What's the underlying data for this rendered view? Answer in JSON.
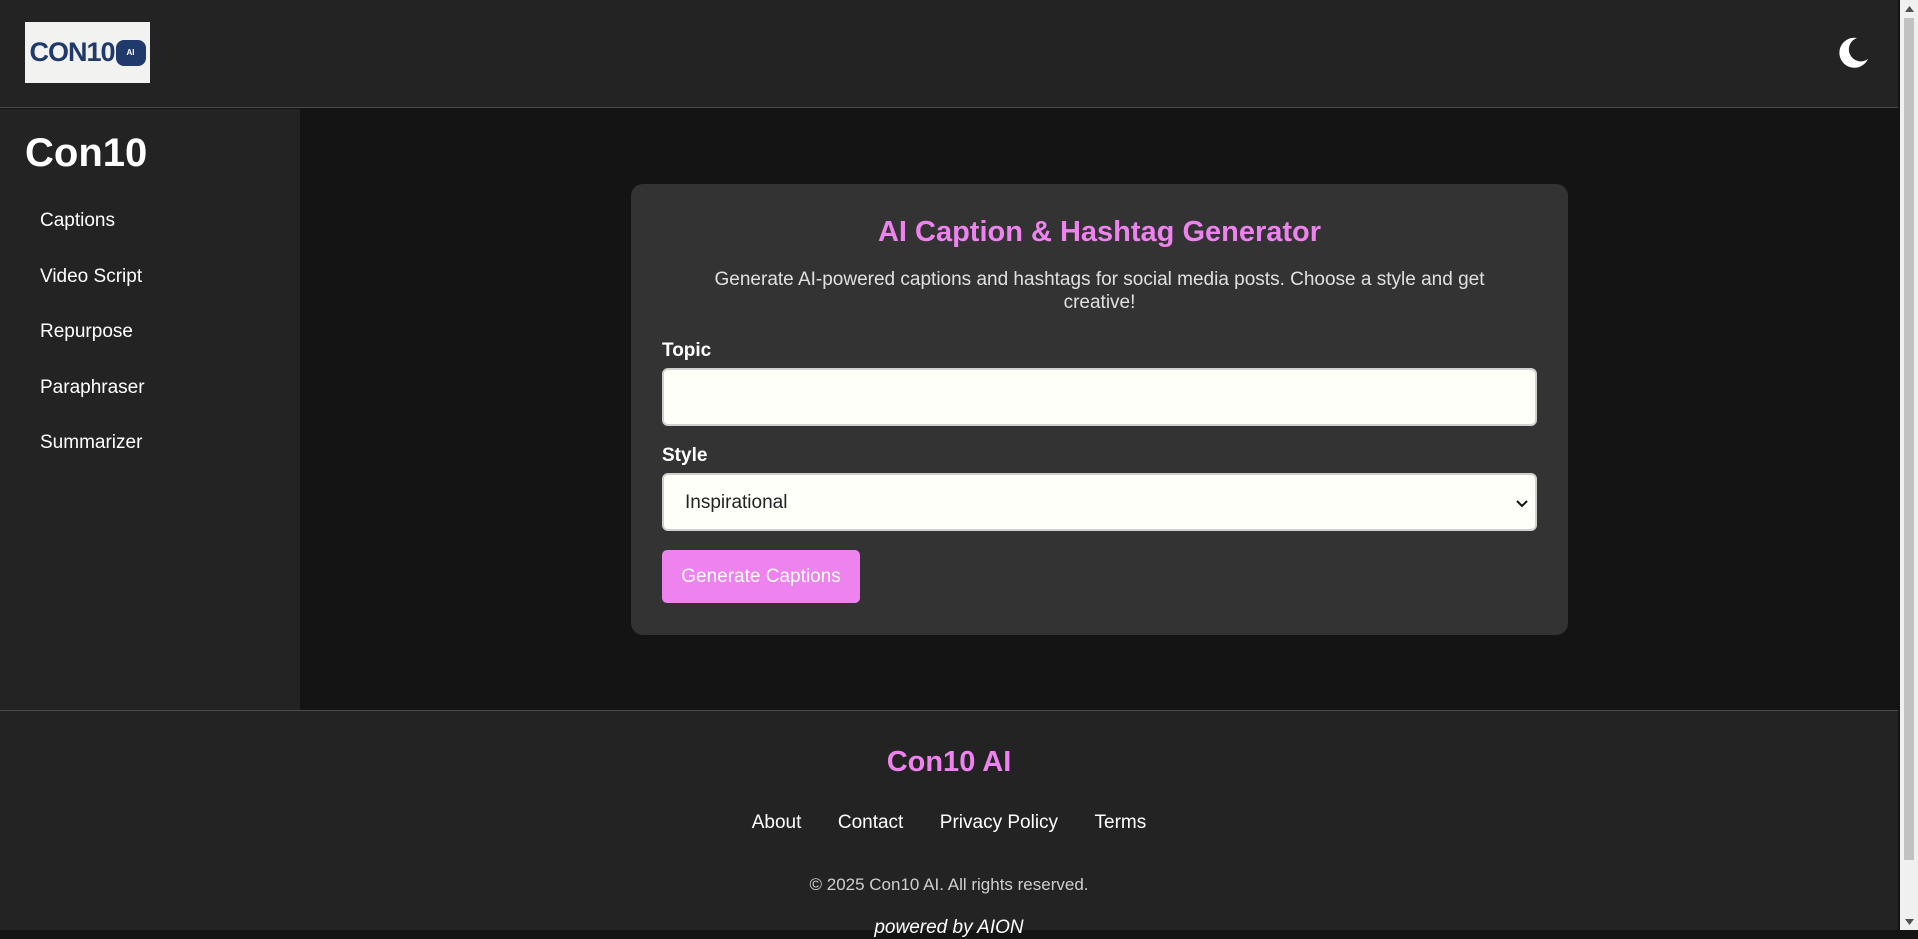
{
  "header": {
    "logo_text": "CON10",
    "logo_badge": "AI",
    "theme_toggle_icon": "moon-icon"
  },
  "sidebar": {
    "title": "Con10",
    "items": [
      {
        "label": "Captions"
      },
      {
        "label": "Video Script"
      },
      {
        "label": "Repurpose"
      },
      {
        "label": "Paraphraser"
      },
      {
        "label": "Summarizer"
      }
    ]
  },
  "main": {
    "title": "AI Caption & Hashtag Generator",
    "description": "Generate AI-powered captions and hashtags for social media posts. Choose a style and get creative!",
    "topic_label": "Topic",
    "topic_value": "",
    "style_label": "Style",
    "style_selected": "Inspirational",
    "generate_button": "Generate Captions"
  },
  "footer": {
    "brand": "Con10 AI",
    "links": [
      "About",
      "Contact",
      "Privacy Policy",
      "Terms"
    ],
    "copyright": "© 2025 Con10 AI. All rights reserved.",
    "powered_by": "powered by AION"
  },
  "colors": {
    "accent": "#ee82ee",
    "background": "#141414",
    "panel": "#232323",
    "card": "#333333"
  }
}
